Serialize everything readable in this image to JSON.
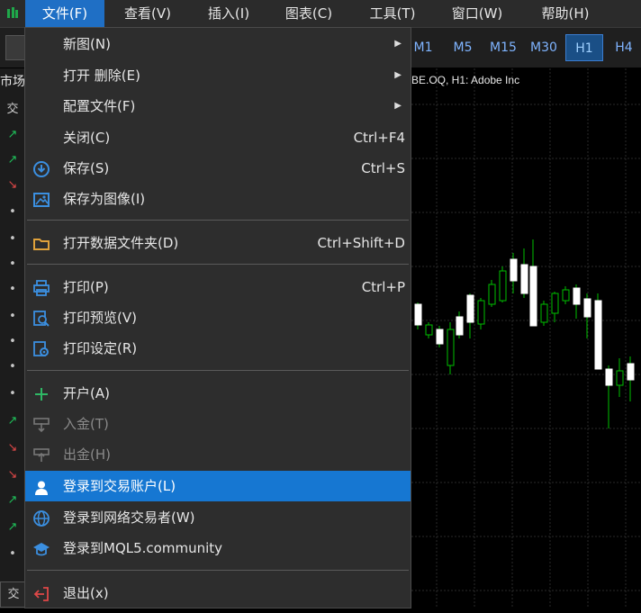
{
  "menubar": {
    "app_icon": "chart-logo-icon",
    "items": [
      {
        "label": "文件(F)"
      },
      {
        "label": "查看(V)"
      },
      {
        "label": "插入(I)"
      },
      {
        "label": "图表(C)"
      },
      {
        "label": "工具(T)"
      },
      {
        "label": "窗口(W)"
      },
      {
        "label": "帮助(H)"
      }
    ]
  },
  "toolbar": {
    "timeframes": [
      "M1",
      "M5",
      "M15",
      "M30",
      "H1",
      "H4"
    ],
    "active_timeframe": "H1"
  },
  "left_panel": {
    "title": "市场",
    "header": "交",
    "bottom_tab": "交"
  },
  "chart": {
    "title": "BE.OQ, H1:  Adobe Inc"
  },
  "file_menu": {
    "new_chart": {
      "label": "新图(N)",
      "submenu": true
    },
    "open_delete": {
      "label": "打开 删除(E)",
      "submenu": true
    },
    "profiles": {
      "label": "配置文件(F)",
      "submenu": true
    },
    "close": {
      "label": "关闭(C)",
      "shortcut": "Ctrl+F4"
    },
    "save": {
      "label": "保存(S)",
      "shortcut": "Ctrl+S",
      "icon": "save-icon"
    },
    "save_image": {
      "label": "保存为图像(I)",
      "icon": "image-icon"
    },
    "open_data_folder": {
      "label": "打开数据文件夹(D)",
      "shortcut": "Ctrl+Shift+D",
      "icon": "folder-icon"
    },
    "print": {
      "label": "打印(P)",
      "shortcut": "Ctrl+P",
      "icon": "printer-icon"
    },
    "print_preview": {
      "label": "打印预览(V)",
      "icon": "print-preview-icon"
    },
    "print_setup": {
      "label": "打印设定(R)",
      "icon": "print-settings-icon"
    },
    "open_account": {
      "label": "开户(A)",
      "icon": "plus-icon"
    },
    "deposit": {
      "label": "入金(T)",
      "icon": "deposit-icon",
      "disabled": true
    },
    "withdraw": {
      "label": "出金(H)",
      "icon": "withdraw-icon",
      "disabled": true
    },
    "login_account": {
      "label": "登录到交易账户(L)",
      "icon": "user-icon",
      "highlighted": true
    },
    "login_web": {
      "label": "登录到网络交易者(W)",
      "icon": "globe-icon"
    },
    "login_mql5": {
      "label": "登录到MQL5.community",
      "icon": "graduation-cap-icon"
    },
    "exit": {
      "label": "退出(x)",
      "icon": "exit-icon"
    }
  },
  "colors": {
    "menu_bg": "#2d2d2d",
    "highlight": "#1677d2",
    "accent_blue": "#3b8fe0",
    "candle_up": "#ffffff",
    "candle_down": "#00c000"
  }
}
